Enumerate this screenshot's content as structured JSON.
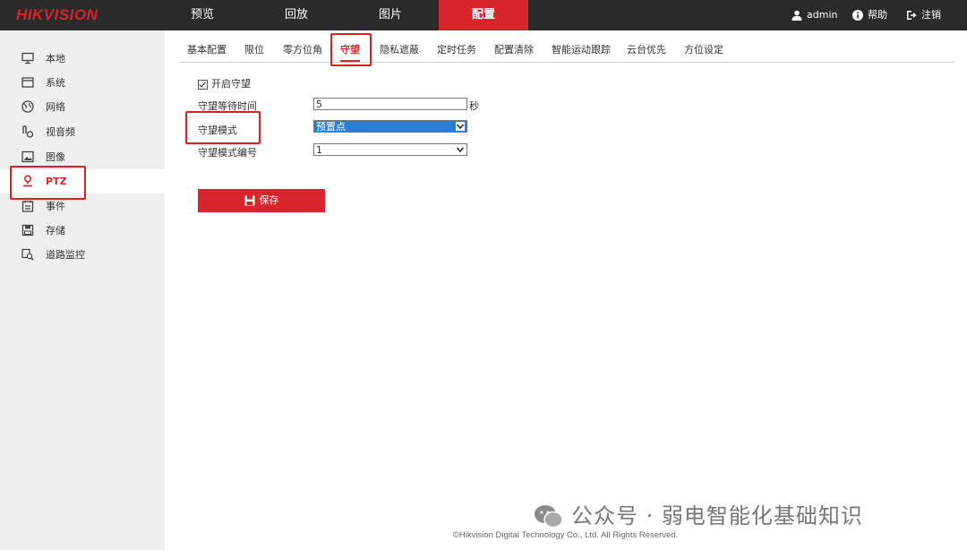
{
  "brand": {
    "logo": "HIKVISION",
    "accent": "#d7262b"
  },
  "top_nav": [
    {
      "label": "预览",
      "active": false
    },
    {
      "label": "回放",
      "active": false
    },
    {
      "label": "图片",
      "active": false
    },
    {
      "label": "配置",
      "active": true
    }
  ],
  "top_right": {
    "user": "admin",
    "help": "帮助",
    "logout": "注销"
  },
  "sidebar": {
    "items": [
      {
        "label": "本地",
        "icon": "monitor-icon"
      },
      {
        "label": "系统",
        "icon": "system-icon"
      },
      {
        "label": "网络",
        "icon": "globe-icon"
      },
      {
        "label": "视音频",
        "icon": "audio-video-icon"
      },
      {
        "label": "图像",
        "icon": "image-icon"
      },
      {
        "label": "PTZ",
        "icon": "ptz-icon",
        "active": true
      },
      {
        "label": "事件",
        "icon": "event-icon"
      },
      {
        "label": "存储",
        "icon": "storage-icon"
      },
      {
        "label": "道路监控",
        "icon": "road-monitor-icon"
      }
    ]
  },
  "tabs": [
    {
      "label": "基本配置"
    },
    {
      "label": "限位"
    },
    {
      "label": "零方位角"
    },
    {
      "label": "守望",
      "active": true
    },
    {
      "label": "隐私遮蔽"
    },
    {
      "label": "定时任务"
    },
    {
      "label": "配置清除"
    },
    {
      "label": "智能运动跟踪"
    },
    {
      "label": "云台优先"
    },
    {
      "label": "方位设定"
    }
  ],
  "form": {
    "enable_label": "开启守望",
    "enable_checked": true,
    "wait_time_label": "守望等待时间",
    "wait_time_value": "5",
    "wait_time_unit": "秒",
    "mode_label": "守望模式",
    "mode_value": "预置点",
    "mode_number_label": "守望模式编号",
    "mode_number_value": "1"
  },
  "save_label": "保存",
  "watermark": "公众号 · 弱电智能化基础知识",
  "footer": "©Hikvision Digital Technology Co., Ltd. All Rights Reserved."
}
